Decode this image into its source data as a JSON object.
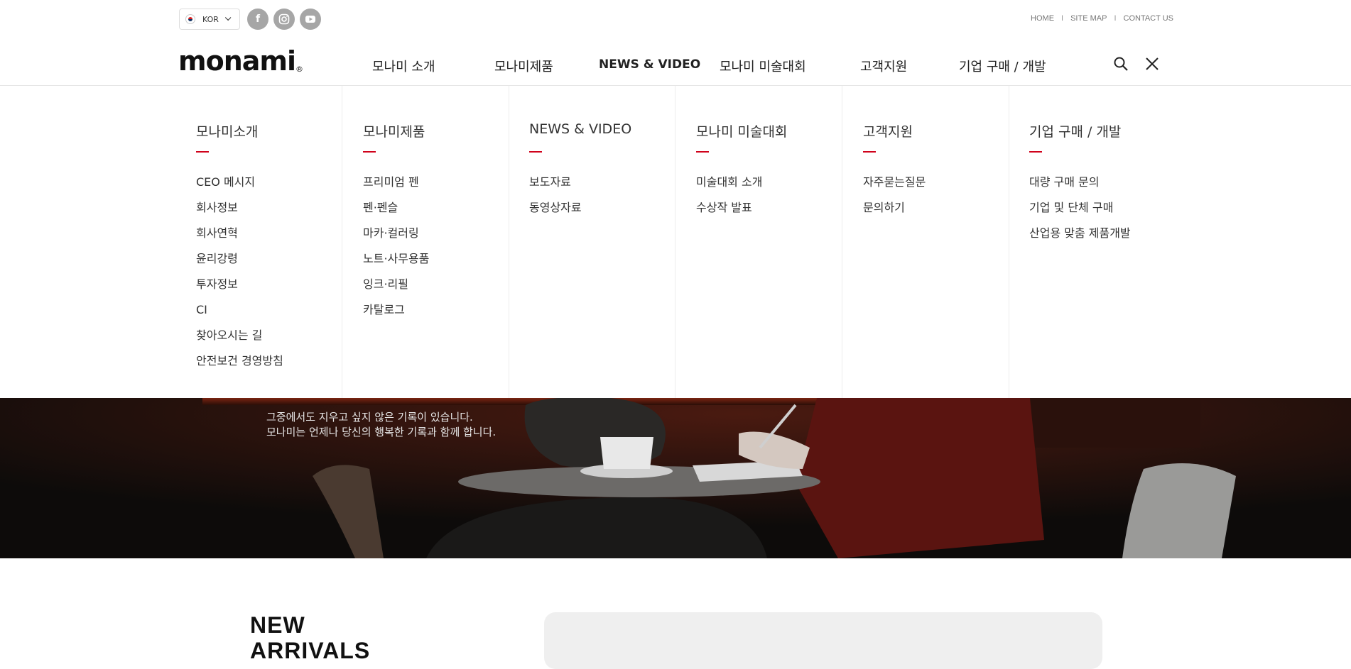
{
  "util": {
    "lang_label": "KOR",
    "social": [
      {
        "name": "facebook-icon",
        "glyph": "f"
      },
      {
        "name": "instagram-icon",
        "glyph": "◎"
      },
      {
        "name": "youtube-icon",
        "glyph": "▶"
      }
    ],
    "links": [
      "HOME",
      "SITE MAP",
      "CONTACT US"
    ]
  },
  "logo": {
    "text": "monami",
    "mark": "®"
  },
  "nav": {
    "items": [
      "모나미 소개",
      "모나미제품",
      "NEWS & VIDEO",
      "모나미 미술대회",
      "고객지원",
      "기업 구매 / 개발"
    ]
  },
  "mega": {
    "columns": [
      {
        "title": "모나미소개",
        "items": [
          "CEO 메시지",
          "회사정보",
          "회사연혁",
          "윤리강령",
          "투자정보",
          "CI",
          "찾아오시는 길",
          "안전보건 경영방침"
        ]
      },
      {
        "title": "모나미제품",
        "items": [
          "프리미엄 펜",
          "펜·펜슬",
          "마카·컬러링",
          "노트·사무용품",
          "잉크·리필",
          "카탈로그"
        ]
      },
      {
        "title": "NEWS & VIDEO",
        "items": [
          "보도자료",
          "동영상자료"
        ]
      },
      {
        "title": "모나미 미술대회",
        "items": [
          "미술대회 소개",
          "수상작 발표"
        ]
      },
      {
        "title": "고객지원",
        "items": [
          "자주묻는질문",
          "문의하기"
        ]
      },
      {
        "title": "기업 구매 / 개발",
        "items": [
          "대량 구매 문의",
          "기업 및 단체 구매",
          "산업용 맞춤 제품개발"
        ]
      }
    ]
  },
  "hero": {
    "line1": "그중에서도 지우고 싶지 않은 기록이 있습니다.",
    "line2": "모나미는 언제나 당신의 행복한 기록과 함께 합니다."
  },
  "section": {
    "title_line1": "NEW",
    "title_line2": "ARRIVALS"
  },
  "colors": {
    "accent": "#d0021b",
    "hero_bg": "#0d0b0a"
  }
}
